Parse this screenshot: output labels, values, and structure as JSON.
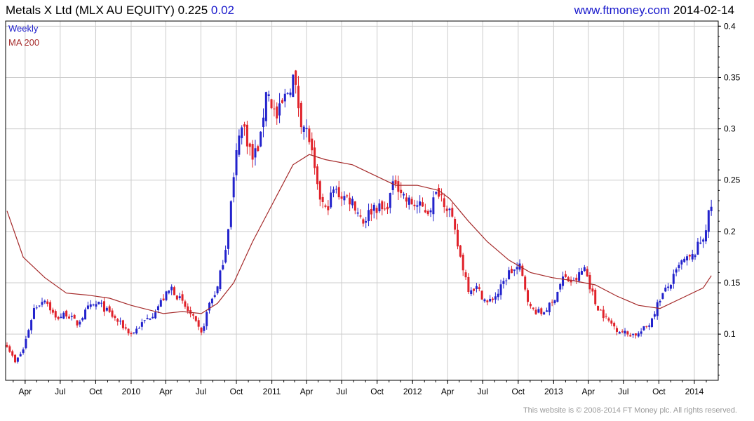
{
  "header": {
    "title": "Metals X Ltd (MLX AU EQUITY)",
    "price": "0.225",
    "change": "0.02",
    "website": "www.ftmoney.com",
    "date": "2014-02-14"
  },
  "footer": "This website is © 2008-2014 FT Money plc. All rights reserved.",
  "colors": {
    "up": "#2222cc",
    "down": "#e0222a",
    "ma": "#a52a2a",
    "grid": "#cccccc",
    "frame": "#000000"
  },
  "chart_data": {
    "type": "candlestick",
    "legend": [
      "Weekly",
      "MA 200"
    ],
    "legend_placement": "top-left",
    "ylim": [
      0.055,
      0.405
    ],
    "y_ticks": [
      0.1,
      0.15,
      0.2,
      0.25,
      0.3,
      0.35,
      0.4
    ],
    "y_tick_labels": [
      "0.1",
      "0.15",
      "0.2",
      "0.25",
      "0.3",
      "0.35",
      "0.4"
    ],
    "x_ticks": [
      {
        "date": "2009-04-01",
        "label": "Apr"
      },
      {
        "date": "2009-07-01",
        "label": "Jul"
      },
      {
        "date": "2009-10-01",
        "label": "Oct"
      },
      {
        "date": "2010-01-01",
        "label": "2010"
      },
      {
        "date": "2010-04-01",
        "label": "Apr"
      },
      {
        "date": "2010-07-01",
        "label": "Jul"
      },
      {
        "date": "2010-10-01",
        "label": "Oct"
      },
      {
        "date": "2011-01-01",
        "label": "2011"
      },
      {
        "date": "2011-04-01",
        "label": "Apr"
      },
      {
        "date": "2011-07-01",
        "label": "Jul"
      },
      {
        "date": "2011-10-01",
        "label": "Oct"
      },
      {
        "date": "2012-01-01",
        "label": "2012"
      },
      {
        "date": "2012-04-01",
        "label": "Apr"
      },
      {
        "date": "2012-07-01",
        "label": "Jul"
      },
      {
        "date": "2012-10-01",
        "label": "Oct"
      },
      {
        "date": "2013-01-01",
        "label": "2013"
      },
      {
        "date": "2013-04-01",
        "label": "Apr"
      },
      {
        "date": "2013-07-01",
        "label": "Jul"
      },
      {
        "date": "2013-10-01",
        "label": "Oct"
      },
      {
        "date": "2014-01-01",
        "label": "2014"
      }
    ],
    "close_anchors": [
      [
        "2009-02-13",
        0.09
      ],
      [
        "2009-03-06",
        0.072
      ],
      [
        "2009-03-27",
        0.085
      ],
      [
        "2009-04-24",
        0.125
      ],
      [
        "2009-05-22",
        0.135
      ],
      [
        "2009-06-19",
        0.115
      ],
      [
        "2009-07-17",
        0.12
      ],
      [
        "2009-08-14",
        0.11
      ],
      [
        "2009-09-11",
        0.125
      ],
      [
        "2009-10-09",
        0.13
      ],
      [
        "2009-11-06",
        0.12
      ],
      [
        "2009-12-04",
        0.11
      ],
      [
        "2010-01-01",
        0.1
      ],
      [
        "2010-01-29",
        0.11
      ],
      [
        "2010-02-26",
        0.12
      ],
      [
        "2010-03-26",
        0.135
      ],
      [
        "2010-04-16",
        0.145
      ],
      [
        "2010-05-14",
        0.13
      ],
      [
        "2010-06-11",
        0.115
      ],
      [
        "2010-07-02",
        0.1
      ],
      [
        "2010-07-23",
        0.13
      ],
      [
        "2010-08-13",
        0.145
      ],
      [
        "2010-09-03",
        0.185
      ],
      [
        "2010-09-24",
        0.25
      ],
      [
        "2010-10-08",
        0.3
      ],
      [
        "2010-10-22",
        0.3
      ],
      [
        "2010-11-12",
        0.27
      ],
      [
        "2010-12-03",
        0.29
      ],
      [
        "2010-12-17",
        0.34
      ],
      [
        "2011-01-14",
        0.31
      ],
      [
        "2011-02-04",
        0.33
      ],
      [
        "2011-02-25",
        0.35
      ],
      [
        "2011-03-18",
        0.31
      ],
      [
        "2011-04-08",
        0.29
      ],
      [
        "2011-04-29",
        0.24
      ],
      [
        "2011-05-20",
        0.22
      ],
      [
        "2011-06-10",
        0.24
      ],
      [
        "2011-07-01",
        0.235
      ],
      [
        "2011-07-29",
        0.23
      ],
      [
        "2011-08-26",
        0.21
      ],
      [
        "2011-09-23",
        0.225
      ],
      [
        "2011-10-21",
        0.22
      ],
      [
        "2011-11-18",
        0.25
      ],
      [
        "2011-12-16",
        0.23
      ],
      [
        "2012-01-13",
        0.225
      ],
      [
        "2012-02-10",
        0.22
      ],
      [
        "2012-03-09",
        0.24
      ],
      [
        "2012-04-06",
        0.22
      ],
      [
        "2012-05-04",
        0.175
      ],
      [
        "2012-05-25",
        0.145
      ],
      [
        "2012-06-15",
        0.145
      ],
      [
        "2012-07-13",
        0.13
      ],
      [
        "2012-08-10",
        0.14
      ],
      [
        "2012-09-07",
        0.16
      ],
      [
        "2012-10-05",
        0.165
      ],
      [
        "2012-11-02",
        0.125
      ],
      [
        "2012-11-30",
        0.12
      ],
      [
        "2012-12-28",
        0.13
      ],
      [
        "2013-01-25",
        0.155
      ],
      [
        "2013-02-22",
        0.15
      ],
      [
        "2013-03-22",
        0.165
      ],
      [
        "2013-04-19",
        0.13
      ],
      [
        "2013-05-17",
        0.115
      ],
      [
        "2013-06-14",
        0.105
      ],
      [
        "2013-07-12",
        0.1
      ],
      [
        "2013-08-09",
        0.1
      ],
      [
        "2013-09-06",
        0.11
      ],
      [
        "2013-10-04",
        0.135
      ],
      [
        "2013-11-01",
        0.15
      ],
      [
        "2013-11-29",
        0.17
      ],
      [
        "2013-12-27",
        0.175
      ],
      [
        "2014-01-24",
        0.195
      ],
      [
        "2014-02-14",
        0.225
      ]
    ],
    "ma200": [
      [
        "2009-02-13",
        0.22
      ],
      [
        "2009-03-27",
        0.175
      ],
      [
        "2009-05-22",
        0.155
      ],
      [
        "2009-07-17",
        0.14
      ],
      [
        "2009-09-11",
        0.138
      ],
      [
        "2009-11-06",
        0.135
      ],
      [
        "2010-01-01",
        0.128
      ],
      [
        "2010-03-26",
        0.12
      ],
      [
        "2010-05-14",
        0.122
      ],
      [
        "2010-07-02",
        0.12
      ],
      [
        "2010-08-13",
        0.13
      ],
      [
        "2010-09-24",
        0.15
      ],
      [
        "2010-11-12",
        0.19
      ],
      [
        "2011-01-14",
        0.235
      ],
      [
        "2011-02-25",
        0.265
      ],
      [
        "2011-04-08",
        0.275
      ],
      [
        "2011-05-20",
        0.27
      ],
      [
        "2011-07-29",
        0.265
      ],
      [
        "2011-09-23",
        0.255
      ],
      [
        "2011-11-18",
        0.245
      ],
      [
        "2012-01-13",
        0.245
      ],
      [
        "2012-03-09",
        0.24
      ],
      [
        "2012-04-06",
        0.232
      ],
      [
        "2012-05-25",
        0.21
      ],
      [
        "2012-07-13",
        0.19
      ],
      [
        "2012-09-07",
        0.172
      ],
      [
        "2012-11-02",
        0.16
      ],
      [
        "2012-12-28",
        0.155
      ],
      [
        "2013-02-22",
        0.152
      ],
      [
        "2013-04-19",
        0.148
      ],
      [
        "2013-06-14",
        0.137
      ],
      [
        "2013-08-09",
        0.128
      ],
      [
        "2013-10-04",
        0.125
      ],
      [
        "2013-11-29",
        0.135
      ],
      [
        "2014-01-24",
        0.145
      ],
      [
        "2014-02-14",
        0.157
      ]
    ]
  }
}
